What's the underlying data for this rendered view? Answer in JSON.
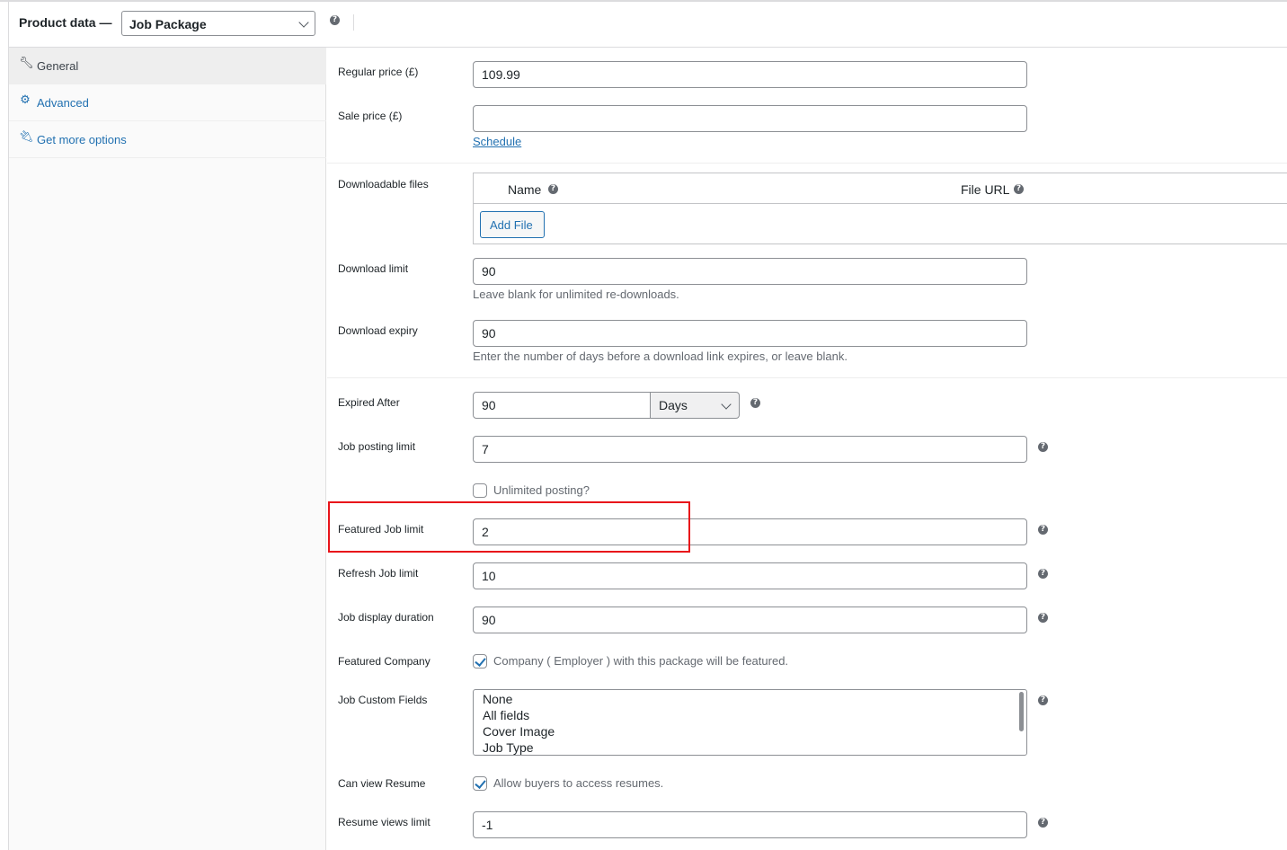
{
  "header": {
    "title": "Product data —",
    "product_type": "Job Package"
  },
  "sidebar": {
    "items": [
      {
        "label": "General",
        "icon": "wrench-icon"
      },
      {
        "label": "Advanced",
        "icon": "gear-icon"
      },
      {
        "label": "Get more options",
        "icon": "plugin-icon"
      }
    ]
  },
  "general": {
    "regular_price_label": "Regular price (£)",
    "regular_price_value": "109.99",
    "sale_price_label": "Sale price (£)",
    "sale_price_value": "",
    "schedule_link": "Schedule",
    "downloadable_files_label": "Downloadable files",
    "files_col_name": "Name",
    "files_col_url": "File URL",
    "add_file_button": "Add File",
    "download_limit_label": "Download limit",
    "download_limit_value": "90",
    "download_limit_desc": "Leave blank for unlimited re-downloads.",
    "download_expiry_label": "Download expiry",
    "download_expiry_value": "90",
    "download_expiry_desc": "Enter the number of days before a download link expires, or leave blank.",
    "expired_after_label": "Expired After",
    "expired_after_value": "90",
    "expired_after_unit": "Days",
    "job_posting_limit_label": "Job posting limit",
    "job_posting_limit_value": "7",
    "unlimited_posting_label": "Unlimited posting?",
    "unlimited_posting_checked": false,
    "featured_job_limit_label": "Featured Job limit",
    "featured_job_limit_value": "2",
    "refresh_job_limit_label": "Refresh Job limit",
    "refresh_job_limit_value": "10",
    "job_display_duration_label": "Job display duration",
    "job_display_duration_value": "90",
    "featured_company_label": "Featured Company",
    "featured_company_desc": "Company ( Employer ) with this package will be featured.",
    "featured_company_checked": true,
    "job_custom_fields_label": "Job Custom Fields",
    "job_custom_fields_options": [
      "None",
      "All fields",
      "Cover Image",
      "Job Type"
    ],
    "can_view_resume_label": "Can view Resume",
    "can_view_resume_desc": "Allow buyers to access resumes.",
    "can_view_resume_checked": true,
    "resume_views_limit_label": "Resume views limit",
    "resume_views_limit_value": "-1"
  },
  "colors": {
    "accent": "#2271b1",
    "highlight": "#e8141a"
  }
}
